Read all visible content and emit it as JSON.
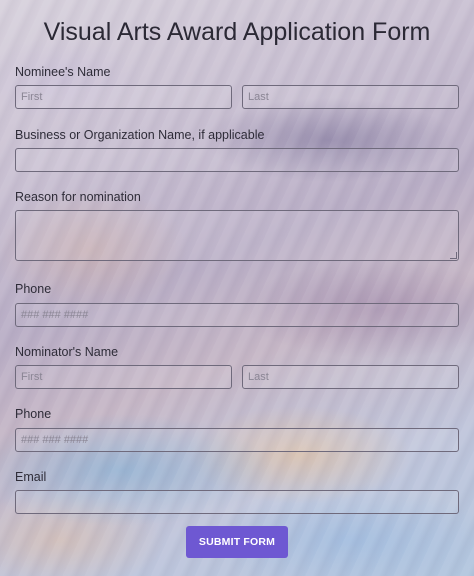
{
  "form": {
    "title": "Visual Arts Award Application Form",
    "nominee": {
      "label": "Nominee's Name",
      "first_placeholder": "First",
      "last_placeholder": "Last"
    },
    "business": {
      "label": "Business or Organization Name, if applicable",
      "value": ""
    },
    "reason": {
      "label": "Reason for nomination",
      "value": ""
    },
    "phone1": {
      "label": "Phone",
      "placeholder": "### ### ####"
    },
    "nominator": {
      "label": "Nominator's Name",
      "first_placeholder": "First",
      "last_placeholder": "Last"
    },
    "phone2": {
      "label": "Phone",
      "placeholder": "### ### ####"
    },
    "email": {
      "label": "Email",
      "value": ""
    },
    "submit_label": "SUBMIT FORM"
  },
  "colors": {
    "accent": "#6e58d2",
    "field_border": "#6f6a7c"
  }
}
